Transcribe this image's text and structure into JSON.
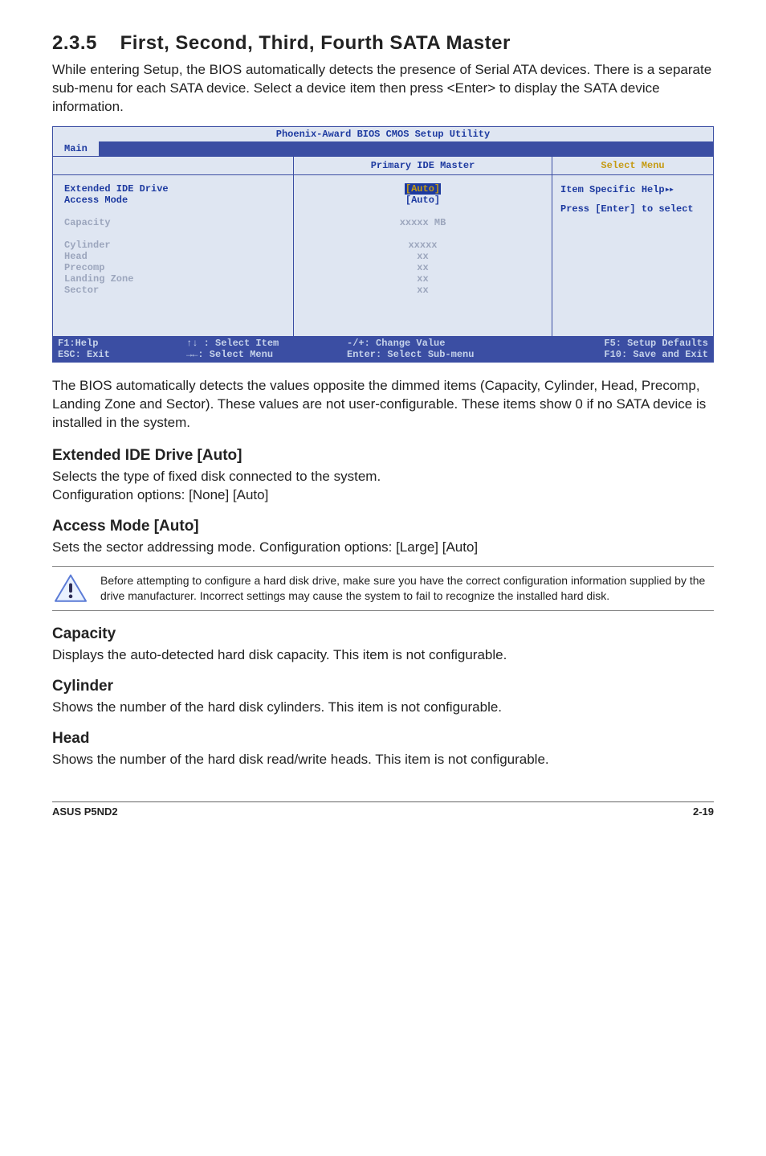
{
  "section": {
    "number": "2.3.5",
    "title": "First, Second, Third, Fourth SATA Master"
  },
  "intro_para": "While entering Setup, the BIOS automatically detects the presence of Serial ATA devices. There is a separate sub-menu for each SATA device. Select a device item then press <Enter> to display the SATA device information.",
  "bios": {
    "utility_title": "Phoenix-Award BIOS CMOS Setup Utility",
    "tab": "Main",
    "header_mid": "Primary IDE Master",
    "header_right": "Select Menu",
    "rows": [
      {
        "label": "Extended IDE Drive",
        "value": "[Auto]",
        "selected": true,
        "dim": false
      },
      {
        "label": "Access Mode",
        "value": "[Auto]",
        "selected": false,
        "dim": false
      },
      {
        "label": "",
        "value": "",
        "selected": false,
        "dim": false
      },
      {
        "label": "Capacity",
        "value": "xxxxx MB",
        "selected": false,
        "dim": true
      },
      {
        "label": "",
        "value": "",
        "selected": false,
        "dim": false
      },
      {
        "label": "Cylinder",
        "value": "xxxxx",
        "selected": false,
        "dim": true
      },
      {
        "label": "Head",
        "value": "xx",
        "selected": false,
        "dim": true
      },
      {
        "label": "Precomp",
        "value": "xx",
        "selected": false,
        "dim": true
      },
      {
        "label": "Landing Zone",
        "value": "xx",
        "selected": false,
        "dim": true
      },
      {
        "label": "Sector",
        "value": "xx",
        "selected": false,
        "dim": true
      }
    ],
    "help_line1": "Item Specific Help",
    "help_line2": "Press [Enter] to select",
    "foot": {
      "f1": "F1:Help",
      "sel_item": "↑↓ : Select Item",
      "change": "-/+: Change Value",
      "f5": "F5: Setup Defaults",
      "esc": "ESC: Exit",
      "sel_menu": "→←: Select Menu",
      "enter": "Enter: Select Sub-menu",
      "f10": "F10: Save and Exit"
    }
  },
  "post_bios_para": "The BIOS automatically detects the values opposite the dimmed items (Capacity, Cylinder, Head, Precomp, Landing Zone and Sector). These values are not user-configurable. These items show 0 if no SATA device is installed in the system.",
  "ext_ide": {
    "heading": "Extended IDE Drive [Auto]",
    "line1": "Selects the type of fixed disk connected to the system.",
    "line2": "Configuration options: [None] [Auto]"
  },
  "access_mode": {
    "heading": "Access Mode [Auto]",
    "line1": "Sets the sector addressing mode. Configuration options: [Large] [Auto]"
  },
  "warning_text": "Before attempting to configure a hard disk drive, make sure you have the correct configuration information supplied by the drive manufacturer. Incorrect settings may cause the system to fail to recognize the installed hard disk.",
  "capacity": {
    "heading": "Capacity",
    "line1": "Displays the auto-detected hard disk capacity. This item is not configurable."
  },
  "cylinder": {
    "heading": "Cylinder",
    "line1": "Shows the number of the hard disk cylinders. This item is not configurable."
  },
  "head": {
    "heading": "Head",
    "line1": "Shows the number of the hard disk read/write heads. This item is not configurable."
  },
  "footer": {
    "left": "ASUS P5ND2",
    "right": "2-19"
  }
}
